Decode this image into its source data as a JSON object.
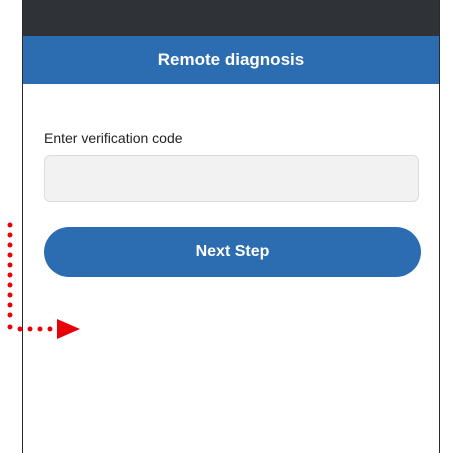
{
  "header": {
    "title": "Remote diagnosis"
  },
  "form": {
    "label": "Enter verification code",
    "input_value": "",
    "input_placeholder": "",
    "next_button_label": "Next Step"
  },
  "colors": {
    "status_bar": "#2f3337",
    "title_bar": "#2c6db2",
    "button": "#2c6db2",
    "input_background": "#f2f2f2",
    "annotation_arrow": "#e8000b"
  },
  "annotation": {
    "icon": "dotted-arrow-right-icon"
  }
}
